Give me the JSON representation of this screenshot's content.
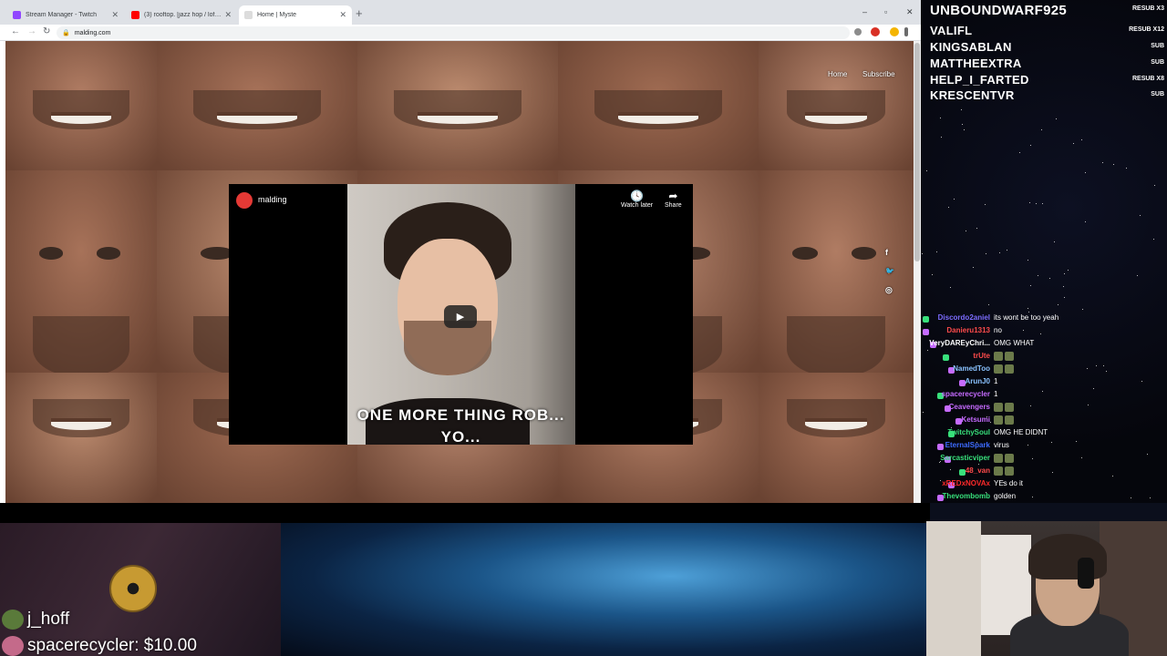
{
  "browser": {
    "tabs": [
      {
        "title": "Stream Manager - Twitch",
        "favicon_color": "#9146ff",
        "active": false
      },
      {
        "title": "(3) rooftop. [jazz hop / lofi / chill",
        "favicon_color": "#ff0000",
        "active": false
      },
      {
        "title": "Home | Myste",
        "favicon_color": "#cfcfcf",
        "active": true
      }
    ],
    "new_tab_symbol": "+",
    "url": "malding.com",
    "window_controls": [
      "–",
      "▫",
      "✕"
    ]
  },
  "site": {
    "nav": [
      "Home",
      "Subscribe"
    ],
    "social": [
      "f",
      "🐦",
      "◎"
    ]
  },
  "video": {
    "channel": "malding",
    "watch_later": "Watch later",
    "share": "Share",
    "caption_line1": "ONE MORE THING ROB...",
    "caption_line2": "YO..."
  },
  "alerts": [
    {
      "name": "UNBOUNDWARF925",
      "tag": "RESUB X3"
    },
    {
      "name": "VALIFL",
      "tag": "RESUB X12"
    },
    {
      "name": "KINGSABLAN",
      "tag": "SUB"
    },
    {
      "name": "MATTHEEXTRA",
      "tag": "SUB"
    },
    {
      "name": "HELP_I_FARTED",
      "tag": "RESUB X8"
    },
    {
      "name": "KRESCENTVR",
      "tag": "SUB"
    }
  ],
  "chat": [
    {
      "user": "Discordo2aniel",
      "color": "#7c6cff",
      "msg": "its wont be too yeah"
    },
    {
      "user": "Danieru1313",
      "color": "#ff4b4b",
      "msg": "no"
    },
    {
      "user": "VeryDAREyChri...",
      "color": "#ffffff",
      "msg": "OMG WHAT"
    },
    {
      "user": "trUte",
      "color": "#ff4b4b",
      "msg": ""
    },
    {
      "user": "NamedToo",
      "color": "#8ac2ff",
      "msg": ""
    },
    {
      "user": "ArunJ0",
      "color": "#8ac2ff",
      "msg": "1"
    },
    {
      "user": "spacerecycler",
      "color": "#c66bff",
      "msg": "1"
    },
    {
      "user": "Ceavengers",
      "color": "#c66bff",
      "msg": ""
    },
    {
      "user": "Ketsumi",
      "color": "#c66bff",
      "msg": ""
    },
    {
      "user": "TwitchySoul",
      "color": "#38e07b",
      "msg": "OMG HE DIDNT"
    },
    {
      "user": "EternalSpark",
      "color": "#3d6bff",
      "msg": "virus"
    },
    {
      "user": "Sarcasticviper",
      "color": "#38e07b",
      "msg": ""
    },
    {
      "user": "48_van",
      "color": "#ff4b4b",
      "msg": ""
    },
    {
      "user": "xREDxNOVAx",
      "color": "#ff2a2a",
      "msg": "YEs do it"
    },
    {
      "user": "Thevombomb",
      "color": "#38e07b",
      "msg": "golden"
    },
    {
      "user": "NamedToo",
      "color": "#8ac2ff",
      "msg": ""
    }
  ],
  "feed": [
    {
      "text": "j_hoff"
    },
    {
      "text": "spacerecycler: $10.00"
    }
  ]
}
